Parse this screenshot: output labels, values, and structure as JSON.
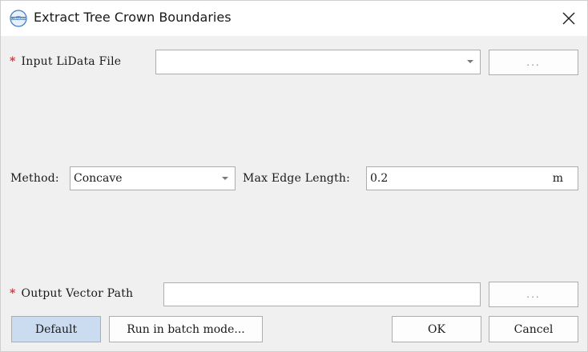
{
  "window": {
    "title": "Extract Tree Crown Boundaries",
    "app_icon_text": "LIDAR360"
  },
  "input": {
    "required_mark": "*",
    "label": "Input LiData File",
    "value": "",
    "browse_label": "..."
  },
  "method": {
    "label": "Method:",
    "value": "Concave"
  },
  "max_edge": {
    "label": "Max Edge Length:",
    "value": "0.2",
    "unit": "m"
  },
  "output": {
    "required_mark": "*",
    "label": "Output Vector Path",
    "value": "",
    "browse_label": "..."
  },
  "buttons": {
    "default": "Default",
    "batch": "Run in batch mode...",
    "ok": "OK",
    "cancel": "Cancel"
  },
  "colors": {
    "required": "#e0262a",
    "primary_button": "#ccdcf0"
  }
}
